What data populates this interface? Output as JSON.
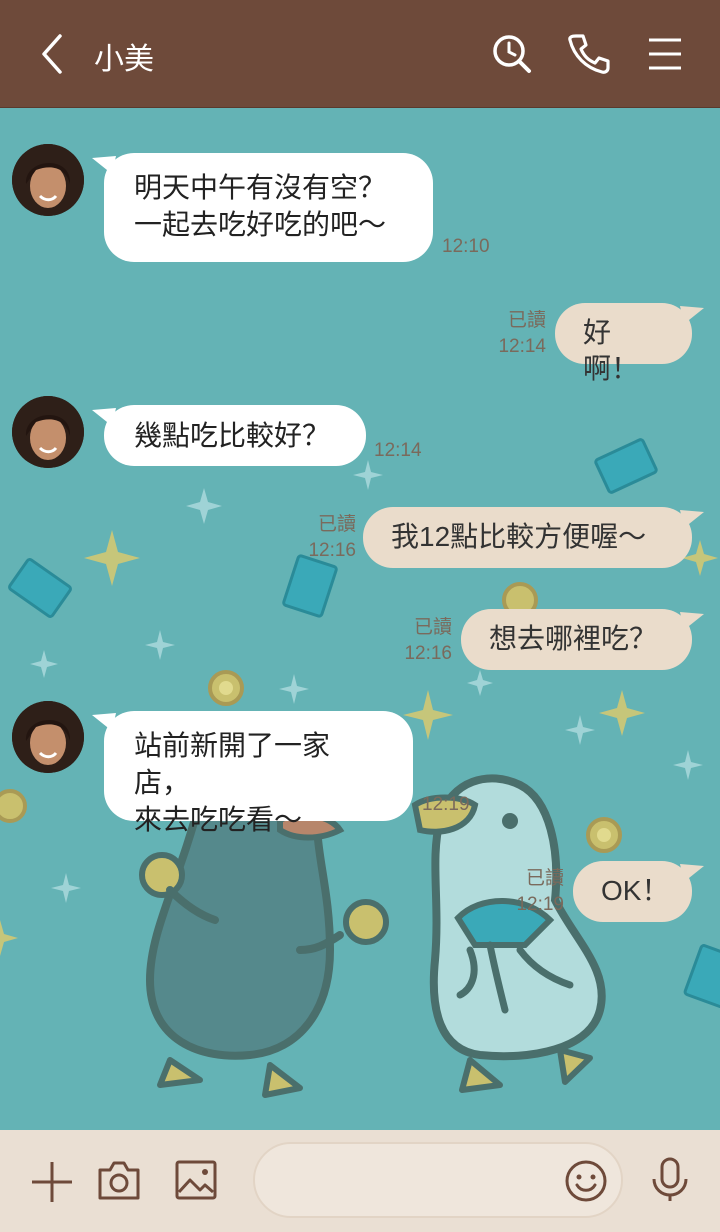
{
  "header": {
    "contact_name": "小美",
    "icons": [
      "back-arrow-icon",
      "search-clock-icon",
      "phone-icon",
      "menu-icon"
    ]
  },
  "colors": {
    "header_bg": "#6e4a3a",
    "chat_bg": "#64b3b5",
    "incoming_bubble": "#ffffff",
    "outgoing_bubble": "#eadccb",
    "bottom_bar": "#eadfd3"
  },
  "messages": [
    {
      "side": "left",
      "text": "明天中午有沒有空？\n一起去吃好吃的吧〜",
      "time": "12:10"
    },
    {
      "side": "right",
      "text": "好啊！",
      "read": "已讀",
      "time": "12:14"
    },
    {
      "side": "left",
      "text": "幾點吃比較好？",
      "time": "12:14"
    },
    {
      "side": "right",
      "text": "我12點比較方便喔〜",
      "read": "已讀",
      "time": "12:16"
    },
    {
      "side": "right",
      "text": "想去哪裡吃？",
      "read": "已讀",
      "time": "12:16"
    },
    {
      "side": "left",
      "text": "站前新開了一家店，\n來去吃吃看〜",
      "time": "12:19"
    },
    {
      "side": "right",
      "text": "OK！",
      "read": "已讀",
      "time": "12:19"
    }
  ],
  "bottom_bar": {
    "icons": [
      "plus-icon",
      "camera-icon",
      "image-icon",
      "smiley-icon",
      "microphone-icon"
    ],
    "input_value": ""
  }
}
